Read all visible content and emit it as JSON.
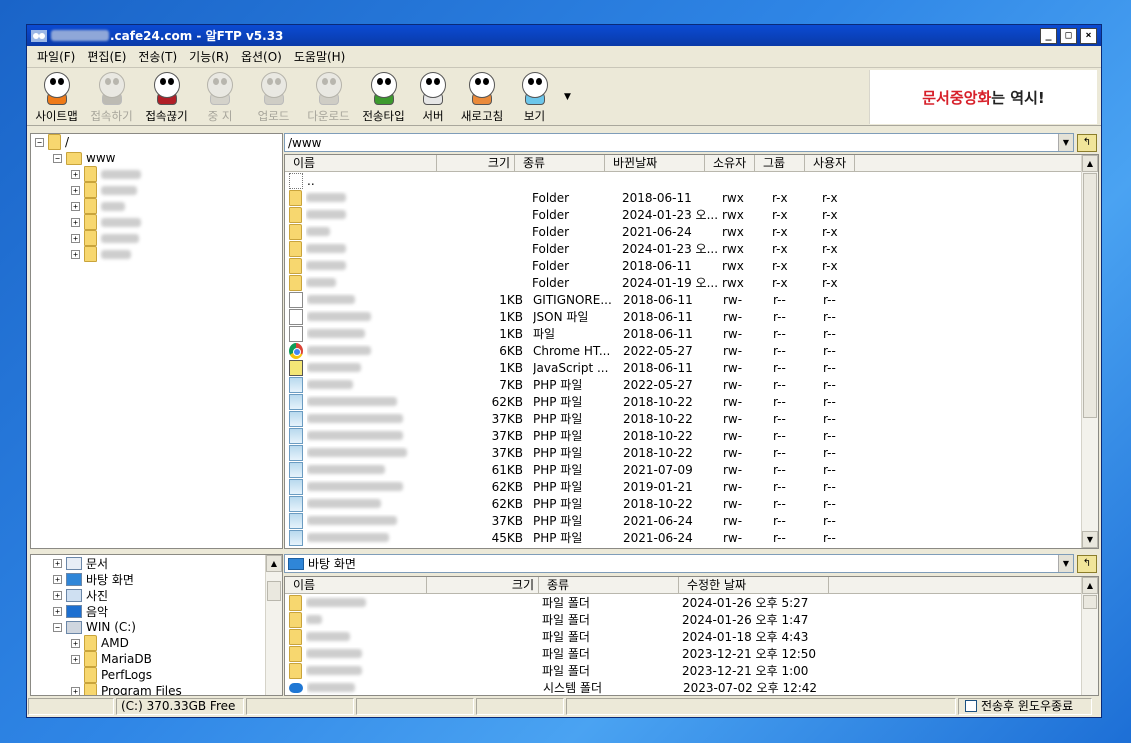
{
  "window": {
    "title_suffix": ".cafe24.com - 알FTP v5.33",
    "minimize": "_",
    "maximize": "□",
    "close": "×"
  },
  "menu": [
    "파일(F)",
    "편집(E)",
    "전송(T)",
    "기능(R)",
    "옵션(O)",
    "도움말(H)"
  ],
  "toolbar": {
    "buttons": [
      {
        "label": "사이트맵",
        "enabled": true,
        "color": "#ef7a18"
      },
      {
        "label": "접속하기",
        "enabled": false,
        "color": "#bdbbb3"
      },
      {
        "label": "접속끊기",
        "enabled": true,
        "color": "#b11f27"
      },
      {
        "label": "중 지",
        "enabled": false,
        "color": "#d4d2ca"
      },
      {
        "label": "업로드",
        "enabled": false,
        "color": "#cfcdc5"
      },
      {
        "label": "다운로드",
        "enabled": false,
        "color": "#cfcdc5"
      },
      {
        "label": "전송타입",
        "enabled": true,
        "color": "#3d9a2e"
      },
      {
        "label": "서버",
        "enabled": true,
        "color": "#e6e6e6"
      },
      {
        "label": "새로고침",
        "enabled": true,
        "color": "#ea8a3a"
      },
      {
        "label": "보기",
        "enabled": true,
        "color": "#6cc6ea"
      }
    ],
    "more": "▼",
    "ad_red": "문서중앙화",
    "ad_black": "는 역시!"
  },
  "remote_tree": {
    "root": "/",
    "folder": "www"
  },
  "remote": {
    "path": "/www",
    "columns": [
      "이름",
      "크기",
      "종류",
      "바뀐날짜",
      "소유자",
      "그룹",
      "사용자"
    ],
    "parent": "..",
    "rows": [
      {
        "icon": "folder",
        "size": "",
        "type": "Folder",
        "date": "2018-06-11",
        "owner": "rwx",
        "group": "r-x",
        "user": "r-x"
      },
      {
        "icon": "folder",
        "size": "",
        "type": "Folder",
        "date": "2024-01-23 오...",
        "owner": "rwx",
        "group": "r-x",
        "user": "r-x"
      },
      {
        "icon": "folder",
        "size": "",
        "type": "Folder",
        "date": "2021-06-24",
        "owner": "rwx",
        "group": "r-x",
        "user": "r-x"
      },
      {
        "icon": "folder",
        "size": "",
        "type": "Folder",
        "date": "2024-01-23 오...",
        "owner": "rwx",
        "group": "r-x",
        "user": "r-x"
      },
      {
        "icon": "folder",
        "size": "",
        "type": "Folder",
        "date": "2018-06-11",
        "owner": "rwx",
        "group": "r-x",
        "user": "r-x"
      },
      {
        "icon": "folder",
        "size": "",
        "type": "Folder",
        "date": "2024-01-19 오...",
        "owner": "rwx",
        "group": "r-x",
        "user": "r-x"
      },
      {
        "icon": "file",
        "size": "1KB",
        "type": "GITIGNORE...",
        "date": "2018-06-11",
        "owner": "rw-",
        "group": "r--",
        "user": "r--"
      },
      {
        "icon": "file",
        "size": "1KB",
        "type": "JSON 파일",
        "date": "2018-06-11",
        "owner": "rw-",
        "group": "r--",
        "user": "r--"
      },
      {
        "icon": "file",
        "size": "1KB",
        "type": "파일",
        "date": "2018-06-11",
        "owner": "rw-",
        "group": "r--",
        "user": "r--"
      },
      {
        "icon": "chrome",
        "size": "6KB",
        "type": "Chrome HT...",
        "date": "2022-05-27",
        "owner": "rw-",
        "group": "r--",
        "user": "r--"
      },
      {
        "icon": "js",
        "size": "1KB",
        "type": "JavaScript ...",
        "date": "2018-06-11",
        "owner": "rw-",
        "group": "r--",
        "user": "r--"
      },
      {
        "icon": "php",
        "size": "7KB",
        "type": "PHP 파일",
        "date": "2022-05-27",
        "owner": "rw-",
        "group": "r--",
        "user": "r--"
      },
      {
        "icon": "php",
        "size": "62KB",
        "type": "PHP 파일",
        "date": "2018-10-22",
        "owner": "rw-",
        "group": "r--",
        "user": "r--"
      },
      {
        "icon": "php",
        "size": "37KB",
        "type": "PHP 파일",
        "date": "2018-10-22",
        "owner": "rw-",
        "group": "r--",
        "user": "r--"
      },
      {
        "icon": "php",
        "size": "37KB",
        "type": "PHP 파일",
        "date": "2018-10-22",
        "owner": "rw-",
        "group": "r--",
        "user": "r--"
      },
      {
        "icon": "php",
        "size": "37KB",
        "type": "PHP 파일",
        "date": "2018-10-22",
        "owner": "rw-",
        "group": "r--",
        "user": "r--"
      },
      {
        "icon": "php",
        "size": "61KB",
        "type": "PHP 파일",
        "date": "2021-07-09",
        "owner": "rw-",
        "group": "r--",
        "user": "r--"
      },
      {
        "icon": "php",
        "size": "62KB",
        "type": "PHP 파일",
        "date": "2019-01-21",
        "owner": "rw-",
        "group": "r--",
        "user": "r--"
      },
      {
        "icon": "php",
        "size": "62KB",
        "type": "PHP 파일",
        "date": "2018-10-22",
        "owner": "rw-",
        "group": "r--",
        "user": "r--"
      },
      {
        "icon": "php",
        "size": "37KB",
        "type": "PHP 파일",
        "date": "2021-06-24",
        "owner": "rw-",
        "group": "r--",
        "user": "r--"
      },
      {
        "icon": "php",
        "size": "45KB",
        "type": "PHP 파일",
        "date": "2021-06-24",
        "owner": "rw-",
        "group": "r--",
        "user": "r--"
      }
    ]
  },
  "local_tree": {
    "items": [
      {
        "label": "문서",
        "level": 1,
        "expander": "+"
      },
      {
        "label": "바탕 화면",
        "level": 1,
        "expander": "+"
      },
      {
        "label": "사진",
        "level": 1,
        "expander": "+"
      },
      {
        "label": "음악",
        "level": 1,
        "expander": "+"
      },
      {
        "label": "WIN (C:)",
        "level": 1,
        "expander": "-"
      },
      {
        "label": "AMD",
        "level": 2,
        "expander": "+"
      },
      {
        "label": "MariaDB",
        "level": 2,
        "expander": "+"
      },
      {
        "label": "PerfLogs",
        "level": 2,
        "expander": ""
      },
      {
        "label": "Program Files",
        "level": 2,
        "expander": "+"
      }
    ]
  },
  "local": {
    "path": "바탕 화면",
    "columns": [
      "이름",
      "크기",
      "종류",
      "수정한 날짜"
    ],
    "rows": [
      {
        "icon": "folder",
        "type": "파일 폴더",
        "date": "2024-01-26 오후 5:27"
      },
      {
        "icon": "folder",
        "type": "파일 폴더",
        "date": "2024-01-26 오후 1:47"
      },
      {
        "icon": "folder",
        "type": "파일 폴더",
        "date": "2024-01-18 오후 4:43"
      },
      {
        "icon": "folder",
        "type": "파일 폴더",
        "date": "2023-12-21 오후 12:50"
      },
      {
        "icon": "folder",
        "type": "파일 폴더",
        "date": "2023-12-21 오후 1:00"
      },
      {
        "icon": "cloud",
        "type": "시스템 폴더",
        "date": "2023-07-02 오후 12:42"
      }
    ]
  },
  "status": {
    "drive": "(C:)  370.33GB Free",
    "close_after_transfer": "전송후 윈도우종료"
  }
}
